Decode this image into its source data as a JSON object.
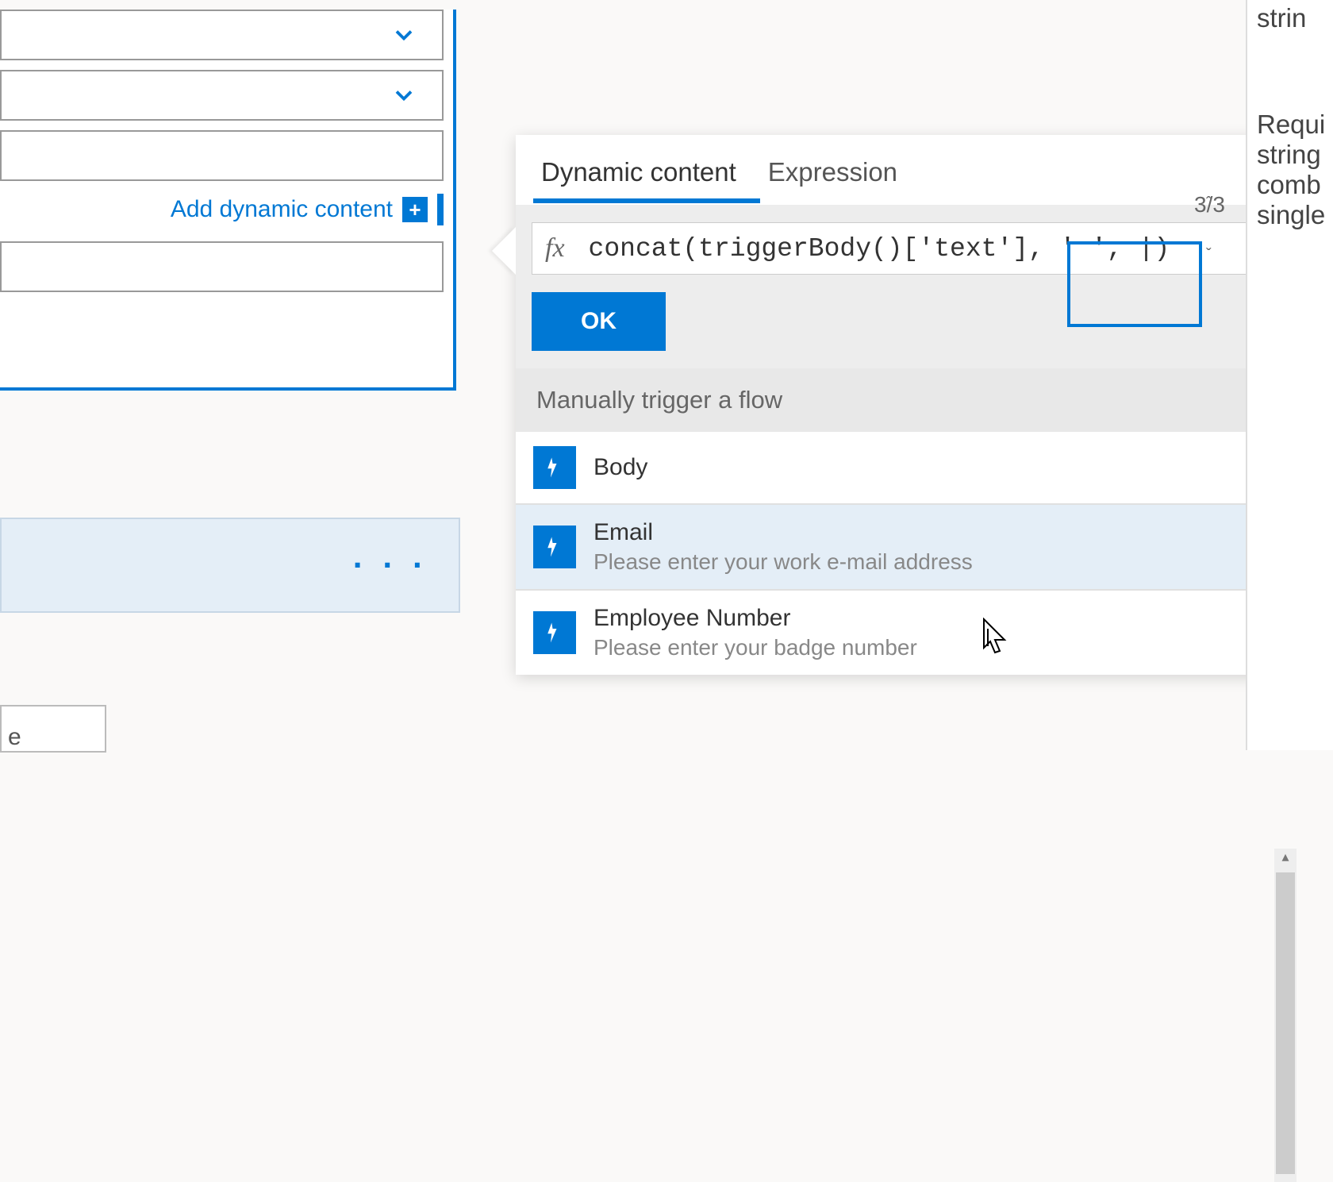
{
  "leftPanel": {
    "addDynamicLabel": "Add dynamic content",
    "lowerBoxChar": "e"
  },
  "popup": {
    "tabs": {
      "dynamic": "Dynamic content",
      "expression": "Expression"
    },
    "navCounter": "3/3",
    "fxLabel": "fx",
    "expression": "concat(triggerBody()['text'], ' ', |)",
    "okLabel": "OK",
    "sectionHeader": "Manually trigger a flow",
    "items": [
      {
        "title": "Body",
        "subtitle": ""
      },
      {
        "title": "Email",
        "subtitle": "Please enter your work e-mail address"
      },
      {
        "title": "Employee Number",
        "subtitle": "Please enter your badge number"
      }
    ]
  },
  "rightPanel": {
    "line1": "strin",
    "line2": "Requi",
    "line3": "string",
    "line4": "comb",
    "line5": "single"
  }
}
